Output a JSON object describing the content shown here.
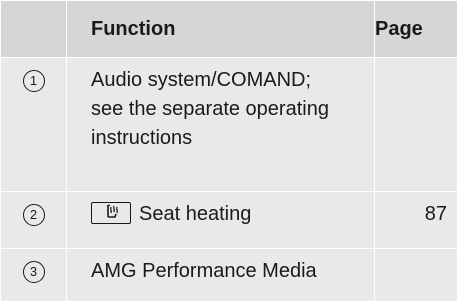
{
  "header": {
    "function_label": "Function",
    "page_label": "Page"
  },
  "rows": [
    {
      "number": "1",
      "text_lines": [
        "Audio system/COMAND;",
        "see the separate operating",
        "instructions"
      ],
      "page": ""
    },
    {
      "number": "2",
      "icon": "seat-heating-icon",
      "text": "Seat heating",
      "page": "87"
    },
    {
      "number": "3",
      "text": "AMG Performance Media",
      "page": ""
    }
  ],
  "colors": {
    "header_bg": "#d6d6d6",
    "row_bg": "#e9e9e9",
    "text": "#1a1a1a"
  }
}
